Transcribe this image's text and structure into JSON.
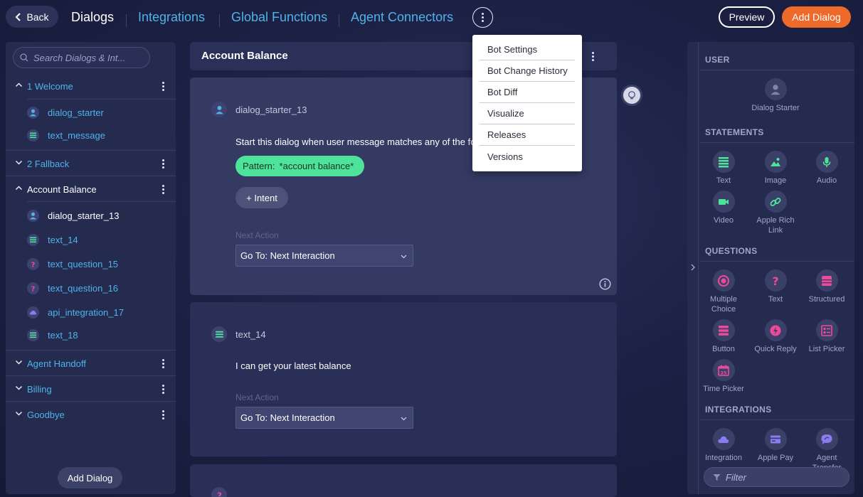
{
  "topbar": {
    "back_label": "Back",
    "tabs": [
      {
        "label": "Dialogs"
      },
      {
        "label": "Integrations"
      },
      {
        "label": "Global Functions"
      },
      {
        "label": "Agent Connectors"
      }
    ],
    "preview_label": "Preview",
    "add_dialog_label": "Add Dialog"
  },
  "menu": {
    "items": [
      {
        "label": "Bot Settings"
      },
      {
        "label": "Bot Change History"
      },
      {
        "label": "Bot Diff"
      },
      {
        "label": "Visualize"
      },
      {
        "label": "Releases"
      },
      {
        "label": "Versions"
      }
    ]
  },
  "sidebar": {
    "search_placeholder": "Search Dialogs & Int...",
    "groups": [
      {
        "title": "1 Welcome",
        "expanded": true,
        "items": [
          {
            "label": "dialog_starter",
            "icon": "user-icon"
          },
          {
            "label": "text_message",
            "icon": "text-icon"
          }
        ]
      },
      {
        "title": "2 Fallback",
        "expanded": false
      },
      {
        "title": "Account Balance",
        "expanded": true,
        "items": [
          {
            "label": "dialog_starter_13",
            "icon": "user-icon"
          },
          {
            "label": "text_14",
            "icon": "text-icon"
          },
          {
            "label": "text_question_15",
            "icon": "question-icon"
          },
          {
            "label": "text_question_16",
            "icon": "question-icon"
          },
          {
            "label": "api_integration_17",
            "icon": "cloud-icon"
          },
          {
            "label": "text_18",
            "icon": "text-icon"
          }
        ]
      },
      {
        "title": "Agent Handoff",
        "expanded": false
      },
      {
        "title": "Billing",
        "expanded": false
      },
      {
        "title": "Goodbye",
        "expanded": false
      }
    ],
    "add_dialog_label": "Add Dialog"
  },
  "main": {
    "dialog_title": "Account Balance",
    "cards": [
      {
        "name": "dialog_starter_13",
        "text": "Start this dialog when user message matches any of the fo",
        "pattern_prefix": "Pattern:",
        "pattern_value": "*account balance*",
        "intent_label": "+ Intent",
        "next_action_label": "Next Action",
        "next_action_value": "Go To: Next Interaction"
      },
      {
        "name": "text_14",
        "text": "I can get your latest balance",
        "next_action_label": "Next Action",
        "next_action_value": "Go To: Next Interaction"
      }
    ]
  },
  "palette": {
    "sections": {
      "user": "USER",
      "statements": "STATEMENTS",
      "questions": "QUESTIONS",
      "integrations": "INTEGRATIONS"
    },
    "user_items": [
      {
        "label": "Dialog Starter",
        "icon": "user-icon"
      }
    ],
    "statement_items": [
      {
        "label": "Text",
        "icon": "text-lines-icon"
      },
      {
        "label": "Image",
        "icon": "image-icon"
      },
      {
        "label": "Audio",
        "icon": "microphone-icon"
      },
      {
        "label": "Video",
        "icon": "video-camera-icon"
      },
      {
        "label": "Apple Rich Link",
        "line1": "Apple Rich",
        "line2": "Link",
        "icon": "link-icon"
      }
    ],
    "question_items": [
      {
        "label": "Multiple Choice",
        "line1": "Multiple",
        "line2": "Choice",
        "icon": "radio-icon"
      },
      {
        "label": "Text",
        "icon": "question-mark-icon"
      },
      {
        "label": "Structured",
        "icon": "structured-icon"
      },
      {
        "label": "Button",
        "icon": "button-list-icon"
      },
      {
        "label": "Quick Reply",
        "icon": "lightning-icon"
      },
      {
        "label": "List Picker",
        "icon": "list-picker-icon"
      },
      {
        "label": "Time Picker",
        "icon": "calendar-icon",
        "calendar_day": "25"
      }
    ],
    "integration_items": [
      {
        "label": "Integration",
        "icon": "cloud-icon"
      },
      {
        "label": "Apple Pay",
        "icon": "credit-card-icon"
      },
      {
        "label": "Agent Transfer",
        "icon": "chat-bubble-icon"
      }
    ],
    "filter_placeholder": "Filter"
  },
  "colors": {
    "accent_link": "#4fb3e8",
    "add_button": "#ee6a2b",
    "pattern_pill": "#4ee39a",
    "statement_icon": "#4ee39a",
    "question_icon": "#ef4a9a",
    "integration_icon": "#8b7bf0",
    "user_icon": "#4fb3e8"
  }
}
